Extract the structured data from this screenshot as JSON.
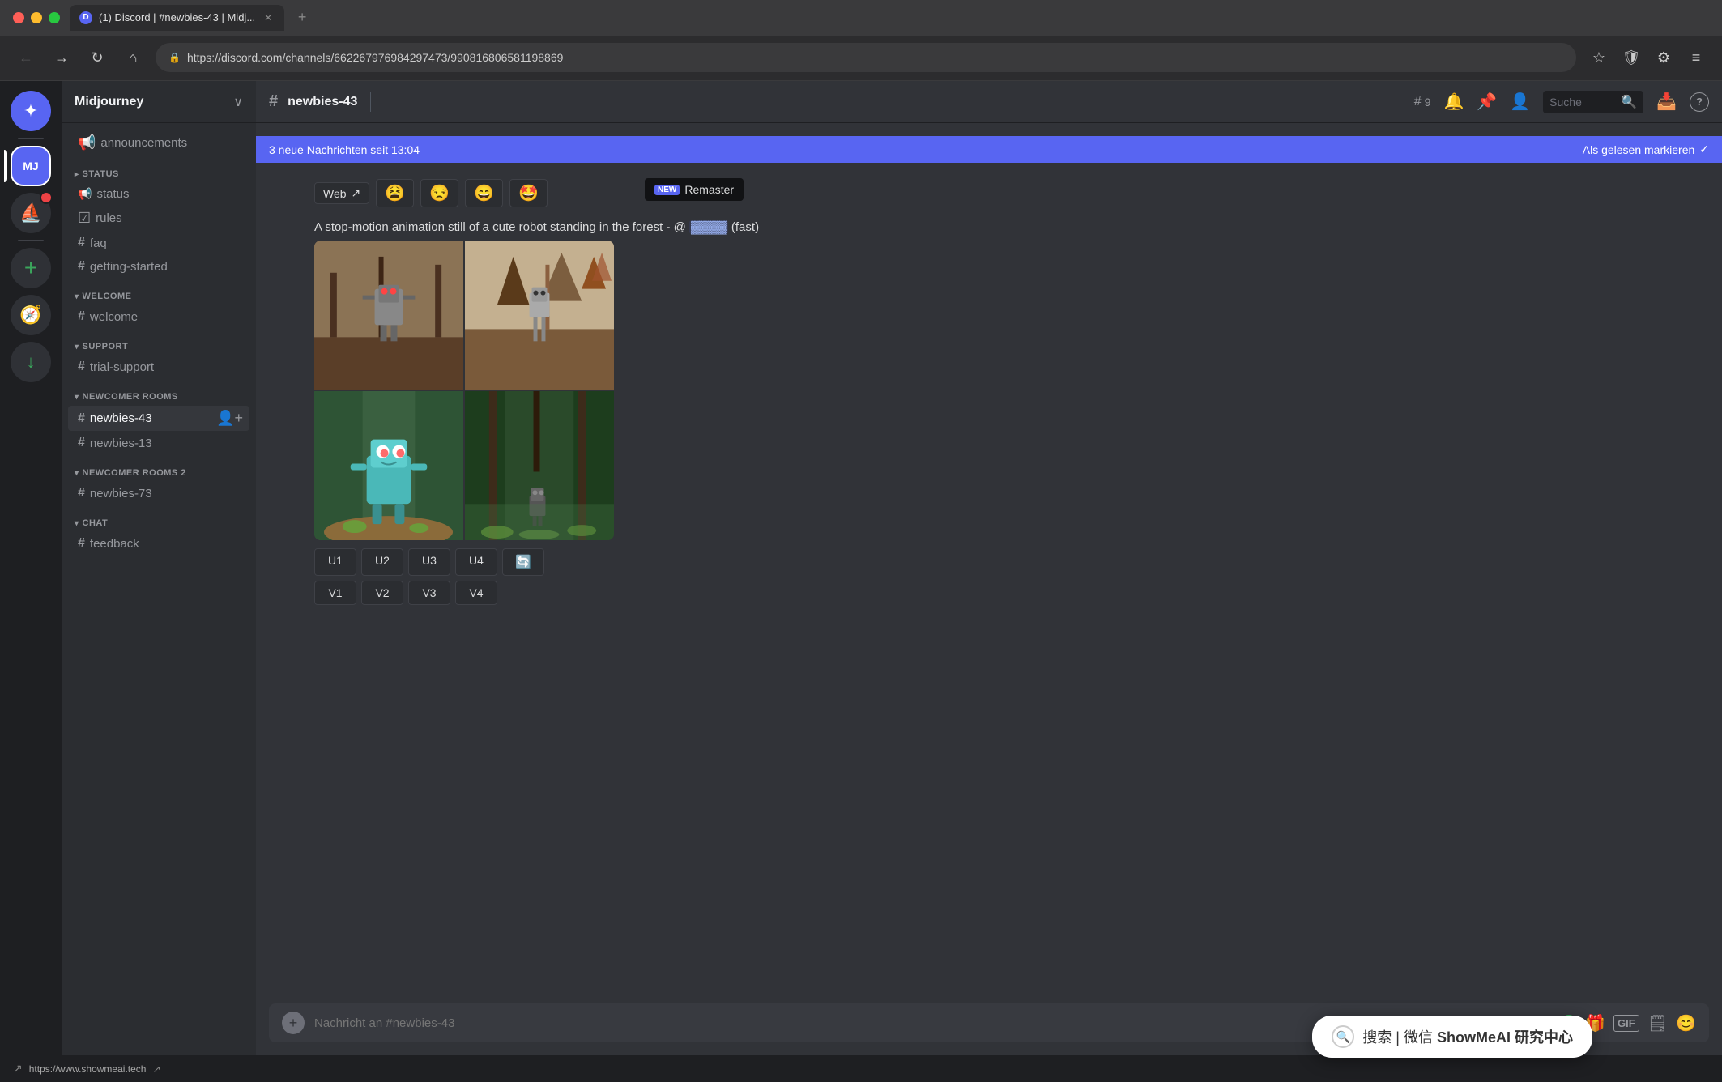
{
  "browser": {
    "tab_title": "(1) Discord | #newbies-43 | Midj...",
    "tab_favicon": "D",
    "url": "https://discord.com/channels/662267976984297473/990816806581198869",
    "back_btn": "←",
    "forward_btn": "→",
    "refresh_btn": "↻",
    "home_btn": "⌂",
    "bookmark_icon": "☆",
    "shield_icon": "🛡",
    "settings_icon": "⚙",
    "menu_icon": "≡"
  },
  "server_sidebar": {
    "discord_icon": "✦",
    "servers": [
      {
        "name": "Midjourney",
        "icon": "🎨",
        "active": true
      },
      {
        "name": "Sailboat",
        "icon": "⛵"
      },
      {
        "name": "Add Server",
        "icon": "+"
      },
      {
        "name": "Explore",
        "icon": "🧭"
      },
      {
        "name": "Download",
        "icon": "↓"
      }
    ]
  },
  "channel_sidebar": {
    "server_name": "Midjourney",
    "channels": [
      {
        "type": "announcement",
        "icon": "📢",
        "name": "announcements"
      },
      {
        "type": "category",
        "name": "STATUS",
        "collapsed": false
      },
      {
        "type": "channel",
        "icon": "#",
        "name": "status"
      },
      {
        "type": "channel",
        "icon": "☑",
        "name": "rules"
      },
      {
        "type": "channel",
        "icon": "#",
        "name": "faq"
      },
      {
        "type": "channel",
        "icon": "#",
        "name": "getting-started"
      },
      {
        "type": "category",
        "name": "WELCOME"
      },
      {
        "type": "channel",
        "icon": "#",
        "name": "welcome"
      },
      {
        "type": "category",
        "name": "SUPPORT"
      },
      {
        "type": "channel",
        "icon": "#",
        "name": "trial-support"
      },
      {
        "type": "category",
        "name": "NEWCOMER ROOMS"
      },
      {
        "type": "channel",
        "icon": "#",
        "name": "newbies-43",
        "active": true
      },
      {
        "type": "channel",
        "icon": "#",
        "name": "newbies-13"
      },
      {
        "type": "category",
        "name": "NEWCOMER ROOMS 2"
      },
      {
        "type": "channel",
        "icon": "#",
        "name": "newbies-73"
      },
      {
        "type": "category",
        "name": "CHAT"
      },
      {
        "type": "channel",
        "icon": "#",
        "name": "feedback"
      }
    ]
  },
  "channel_header": {
    "icon": "#",
    "name": "newbies-43",
    "member_count_icon": "👥",
    "member_count": "9",
    "mute_icon": "🔔",
    "pin_icon": "📌",
    "members_icon": "👤",
    "search_placeholder": "Suche",
    "inbox_icon": "📥",
    "help_icon": "?"
  },
  "new_messages_banner": {
    "text": "3 neue Nachrichten seit 13:04",
    "mark_read": "Als gelesen markieren",
    "checkmark": "✓"
  },
  "remaster_tooltip": {
    "badge": "NEW",
    "text": "Remaster"
  },
  "reaction_bar": {
    "web_text": "Web",
    "web_icon": "↗",
    "emojis": [
      "😫",
      "😒",
      "😄",
      "🤩"
    ]
  },
  "message": {
    "prompt": "A stop-motion animation still of a cute  robot standing in the forest - @",
    "username_hidden": true,
    "speed": "(fast)"
  },
  "action_buttons": {
    "row1": [
      "U1",
      "U2",
      "U3",
      "U4"
    ],
    "row2": [
      "V1",
      "V2",
      "V3",
      "V4"
    ],
    "refresh": "🔄"
  },
  "message_input": {
    "placeholder": "Nachricht an #newbies-43"
  },
  "input_actions": {
    "gift_icon": "🎁",
    "gif_label": "GIF",
    "sticker_icon": "🗒",
    "emoji_icon": "😊"
  },
  "bottom_tooltip": {
    "search_char": "🔍",
    "text_prefix": "搜索 | 微信",
    "brand_name": "ShowMeAI 研究中心"
  },
  "bottom_link": {
    "icon": "↗",
    "url": "https://www.showmeai.tech"
  }
}
